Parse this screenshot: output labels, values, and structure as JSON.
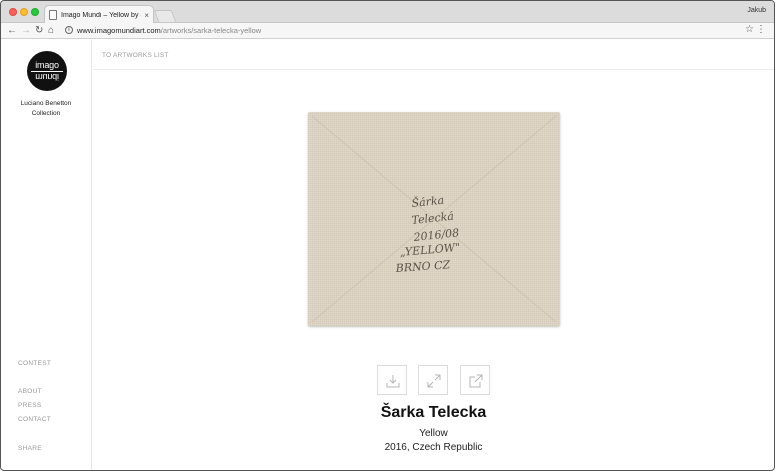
{
  "browser": {
    "tab_title": "Imago Mundi – Yellow by Šarka",
    "tab_close": "×",
    "profile_name": "Jakub",
    "url_host": "www.imagomundiart.com",
    "url_path": "/artworks/sarka-telecka-yellow",
    "icons": {
      "back": "arrow-left",
      "forward": "arrow-right",
      "reload": "reload",
      "home": "home",
      "info": "info",
      "bookmark": "star",
      "menu": "more-vertical"
    }
  },
  "sidebar": {
    "logo_top": "imago",
    "logo_bottom": "mundi",
    "collection": "Luciano Benetton Collection",
    "links": {
      "contest": "CONTEST",
      "about": "ABOUT",
      "press": "PRESS",
      "contact": "CONTACT",
      "share": "SHARE"
    }
  },
  "content": {
    "back_link": "TO ARTWORKS LIST",
    "artwork_inscription": [
      "Šárka",
      "Telecká",
      "2016/08",
      "„YELLOW\"",
      "BRNO CZ"
    ],
    "actions": [
      "download-icon",
      "expand-icon",
      "share-icon"
    ],
    "artist": "Šarka Telecka",
    "title": "Yellow",
    "meta": "2016, Czech Republic"
  },
  "colors": {
    "canvas": "#e3d9c8",
    "accent_text": "#111111",
    "muted_text": "#999999"
  }
}
